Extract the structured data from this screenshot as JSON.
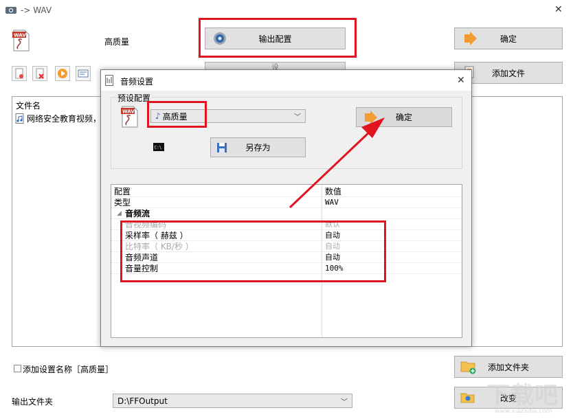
{
  "main_window": {
    "title": "-> WAV",
    "preset_name": "高质量",
    "output_config_label": "输出配置",
    "ok_label": "确定",
    "add_file_label": "添加文件",
    "partial_button_label": "设",
    "file_list": {
      "header": "文件名",
      "items": [
        "网络安全教育视频，"
      ]
    },
    "add_setting_name_label": "添加设置名称［高质量］",
    "add_folder_label": "添加文件夹",
    "output_folder_label": "输出文件夹",
    "output_folder_value": "D:\\FFOutput",
    "change_label": "改变"
  },
  "dialog": {
    "title": "音频设置",
    "preset_group_label": "预设配置",
    "preset_value": "高质量",
    "ok_label": "确定",
    "save_as_label": "另存为",
    "grid": {
      "header_name": "配置",
      "header_value": "数值",
      "rows": [
        {
          "name": "类型",
          "value": "WAV"
        },
        {
          "name": "音频流",
          "value": ""
        },
        {
          "name": "音视频编码",
          "value": "默认"
        },
        {
          "name": "采样率（ 赫兹 ）",
          "value": "自动"
        },
        {
          "name": "比特率（ KB/秒 ）",
          "value": "自动"
        },
        {
          "name": "音频声道",
          "value": "自动"
        },
        {
          "name": "音量控制",
          "value": "100%"
        }
      ]
    }
  },
  "watermark": "下载吧",
  "watermark_url": "www.xiazaiba.com",
  "colors": {
    "highlight_red": "#e0141e",
    "button_face": "#e1e1e1",
    "dialog_bg": "#f0f0f0"
  }
}
